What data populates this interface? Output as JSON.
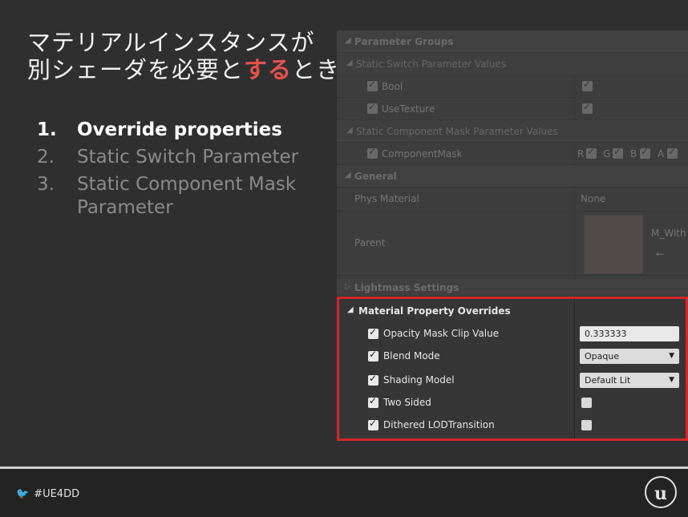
{
  "slide": {
    "title_line1": "マテリアルインスタンスが",
    "title_line2_pre": "別シェーダを必要と",
    "title_line2_highlight": "する",
    "title_line2_post": "とき",
    "highlight_color": "#e8514c",
    "items": [
      {
        "num": "1.",
        "text": "Override properties",
        "state": "active"
      },
      {
        "num": "2.",
        "text": "Static Switch Parameter",
        "state": "dim"
      },
      {
        "num": "3.",
        "text": "Static Component Mask Parameter",
        "state": "dim"
      }
    ]
  },
  "panel": {
    "parameter_groups": "Parameter Groups",
    "static_switch_values": "Static Switch Parameter Values",
    "bool": "Bool",
    "use_texture": "UseTexture",
    "static_component_mask_values": "Static Component Mask Parameter Values",
    "component_mask": "ComponentMask",
    "mask_channels": [
      "R",
      "G",
      "B",
      "A"
    ],
    "general": "General",
    "phys_material": "Phys Material",
    "phys_material_value": "None",
    "parent": "Parent",
    "parent_value": "M_With",
    "lightmass_settings": "Lightmass Settings",
    "overrides_title": "Material Property Overrides",
    "overrides": [
      {
        "label": "Opacity Mask Clip Value",
        "checked": true,
        "type": "field",
        "value": "0.333333"
      },
      {
        "label": "Blend Mode",
        "checked": true,
        "type": "select",
        "value": "Opaque"
      },
      {
        "label": "Shading Model",
        "checked": true,
        "type": "select",
        "value": "Default Lit"
      },
      {
        "label": "Two Sided",
        "checked": true,
        "type": "checkbox",
        "value": false
      },
      {
        "label": "Dithered LODTransition",
        "checked": true,
        "type": "checkbox",
        "value": false
      }
    ],
    "highlight_border_color": "#d4262b"
  },
  "footer": {
    "hashtag": "#UE4DD",
    "twitter_icon": "twitter-bird-icon",
    "logo_icon": "unreal-logo-icon"
  }
}
